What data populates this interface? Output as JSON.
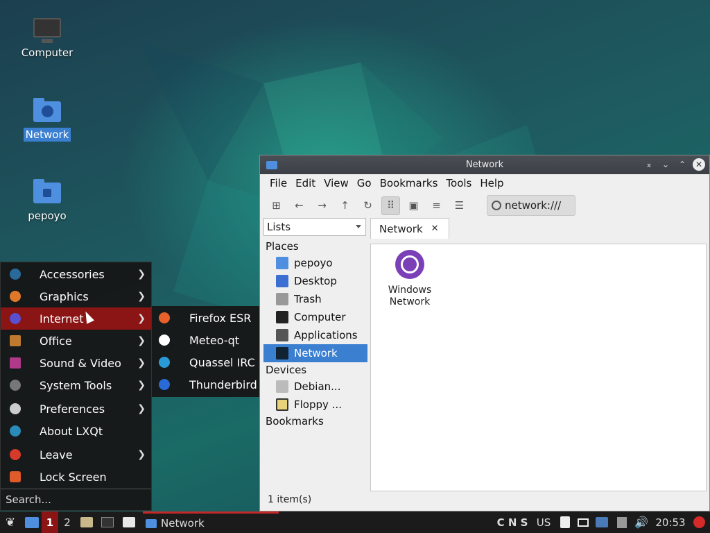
{
  "desktop": {
    "icons": [
      {
        "label": "Computer",
        "icon": "monitor-icon"
      },
      {
        "label": "Network",
        "icon": "network-folder-icon",
        "selected": true
      },
      {
        "label": "pepoyo",
        "icon": "home-folder-icon"
      }
    ]
  },
  "file_manager": {
    "title": "Network",
    "menu": [
      "File",
      "Edit",
      "View",
      "Go",
      "Bookmarks",
      "Tools",
      "Help"
    ],
    "path": "network:///",
    "side_select": "Lists",
    "places_label": "Places",
    "places": [
      "pepoyo",
      "Desktop",
      "Trash",
      "Computer",
      "Applications",
      "Network"
    ],
    "selected_place": "Network",
    "devices_label": "Devices",
    "devices": [
      "Debian...",
      "Floppy ..."
    ],
    "bookmarks_label": "Bookmarks",
    "tab": "Network",
    "items": [
      {
        "label_line1": "Windows",
        "label_line2": "Network",
        "icon": "globe-icon"
      }
    ],
    "status": "1 item(s)",
    "colors": {
      "selection": "#3b7fd1",
      "title_bar": "#3c4046"
    }
  },
  "app_menu": {
    "items": [
      {
        "label": "Accessories",
        "has_submenu": true,
        "icon": "accessories-icon",
        "color": "#2a6a9a"
      },
      {
        "label": "Graphics",
        "has_submenu": true,
        "icon": "graphics-icon",
        "color": "#e0782a"
      },
      {
        "label": "Internet",
        "has_submenu": true,
        "icon": "internet-icon",
        "color": "#5a4fcf",
        "active": true
      },
      {
        "label": "Office",
        "has_submenu": true,
        "icon": "office-icon",
        "color": "#c07a30"
      },
      {
        "label": "Sound & Video",
        "has_submenu": true,
        "icon": "sound-video-icon",
        "color": "#b03a8a"
      },
      {
        "label": "System Tools",
        "has_submenu": true,
        "icon": "system-tools-icon",
        "color": "#777777"
      },
      {
        "label": "Preferences",
        "has_submenu": true,
        "icon": "preferences-icon",
        "color": "#cccccc"
      },
      {
        "label": "About LXQt",
        "has_submenu": false,
        "icon": "lxqt-icon",
        "color": "#2a8ab8"
      },
      {
        "label": "Leave",
        "has_submenu": true,
        "icon": "power-icon",
        "color": "#d63a2a"
      },
      {
        "label": "Lock Screen",
        "has_submenu": false,
        "icon": "lock-icon",
        "color": "#e05a2a"
      }
    ],
    "search_placeholder": "Search...",
    "submenu": [
      {
        "label": "Firefox ESR",
        "icon": "firefox-icon",
        "color": "#e8612a"
      },
      {
        "label": "Meteo-qt",
        "icon": "weather-icon",
        "color": "#ffffff"
      },
      {
        "label": "Quassel IRC",
        "icon": "quassel-icon",
        "color": "#2a9ad6"
      },
      {
        "label": "Thunderbird",
        "icon": "thunderbird-icon",
        "color": "#2a6ad6"
      }
    ],
    "colors": {
      "active": "#8b1414"
    }
  },
  "taskbar": {
    "workspaces": [
      "1",
      "2"
    ],
    "task_label": "Network",
    "indicators": "C N S",
    "keyboard_layout": "US",
    "clock": "20:53"
  }
}
